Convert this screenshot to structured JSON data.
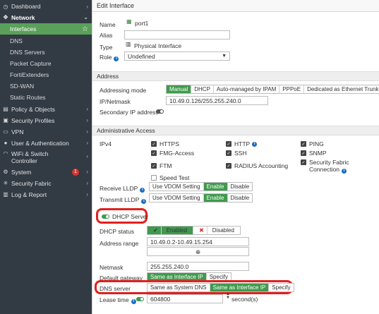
{
  "sidebar": {
    "items": [
      {
        "label": "Dashboard",
        "icon": "dashboard-icon"
      },
      {
        "label": "Network",
        "icon": "network-icon"
      },
      {
        "label": "Interfaces"
      },
      {
        "label": "DNS"
      },
      {
        "label": "DNS Servers"
      },
      {
        "label": "Packet Capture"
      },
      {
        "label": "FortiExtenders"
      },
      {
        "label": "SD-WAN"
      },
      {
        "label": "Static Routes"
      },
      {
        "label": "Policy & Objects",
        "icon": "policy-icon"
      },
      {
        "label": "Security Profiles",
        "icon": "lock-icon"
      },
      {
        "label": "VPN",
        "icon": "vpn-icon"
      },
      {
        "label": "User & Authentication",
        "icon": "user-icon"
      },
      {
        "label": "WiFi & Switch Controller",
        "icon": "wifi-icon"
      },
      {
        "label": "System",
        "icon": "gear-icon",
        "badge": "1"
      },
      {
        "label": "Security Fabric",
        "icon": "fabric-icon"
      },
      {
        "label": "Log & Report",
        "icon": "log-icon"
      }
    ]
  },
  "page": {
    "title": "Edit Interface"
  },
  "general": {
    "name_label": "Name",
    "name_value": "port1",
    "alias_label": "Alias",
    "alias_value": "",
    "type_label": "Type",
    "type_value": "Physical Interface",
    "role_label": "Role",
    "role_value": "Undefined"
  },
  "address": {
    "section_title": "Address",
    "mode_label": "Addressing mode",
    "modes": [
      "Manual",
      "DHCP",
      "Auto-managed by IPAM",
      "PPPoE",
      "Dedicated as Ethernet Trunk"
    ],
    "selected_mode": "Manual",
    "ip_label": "IP/Netmask",
    "ip_value": "10.49.0.126/255.255.240.0",
    "secondary_label": "Secondary IP address"
  },
  "admin": {
    "section_title": "Administrative Access",
    "ipv4_label": "IPv4",
    "items": [
      {
        "label": "HTTPS",
        "checked": true
      },
      {
        "label": "HTTP",
        "checked": true,
        "info": true
      },
      {
        "label": "PING",
        "checked": true
      },
      {
        "label": "FMG-Access",
        "checked": true
      },
      {
        "label": "SSH",
        "checked": true
      },
      {
        "label": "SNMP",
        "checked": true
      },
      {
        "label": "FTM",
        "checked": true
      },
      {
        "label": "RADIUS Accounting",
        "checked": true
      },
      {
        "label": "Security Fabric Connection",
        "checked": true,
        "info": true
      },
      {
        "label": "Speed Test",
        "checked": false
      }
    ],
    "receive_lldp_label": "Receive LLDP",
    "transmit_lldp_label": "Transmit LLDP",
    "lldp_options": [
      "Use VDOM Setting",
      "Enable",
      "Disable"
    ],
    "lldp_selected": "Enable"
  },
  "dhcp": {
    "toggle_label": "DHCP Server",
    "status_label": "DHCP status",
    "status_enabled": "Enabled",
    "status_disabled": "Disabled",
    "range_label": "Address range",
    "range_value": "10.49.0.2-10.49.15.254",
    "netmask_label": "Netmask",
    "netmask_value": "255.255.240.0",
    "gateway_label": "Default gateway",
    "gateway_options": [
      "Same as Interface IP",
      "Specify"
    ],
    "gateway_selected": "Same as Interface IP",
    "dns_label": "DNS server",
    "dns_options": [
      "Same as System DNS",
      "Same as Interface IP",
      "Specify"
    ],
    "dns_selected": "Same as Interface IP",
    "lease_label": "Lease time",
    "lease_value": "604800",
    "lease_unit": "second(s)"
  },
  "colors": {
    "accent": "#3f9a4d",
    "sidebar": "#323a44",
    "highlight": "#e0201e"
  }
}
